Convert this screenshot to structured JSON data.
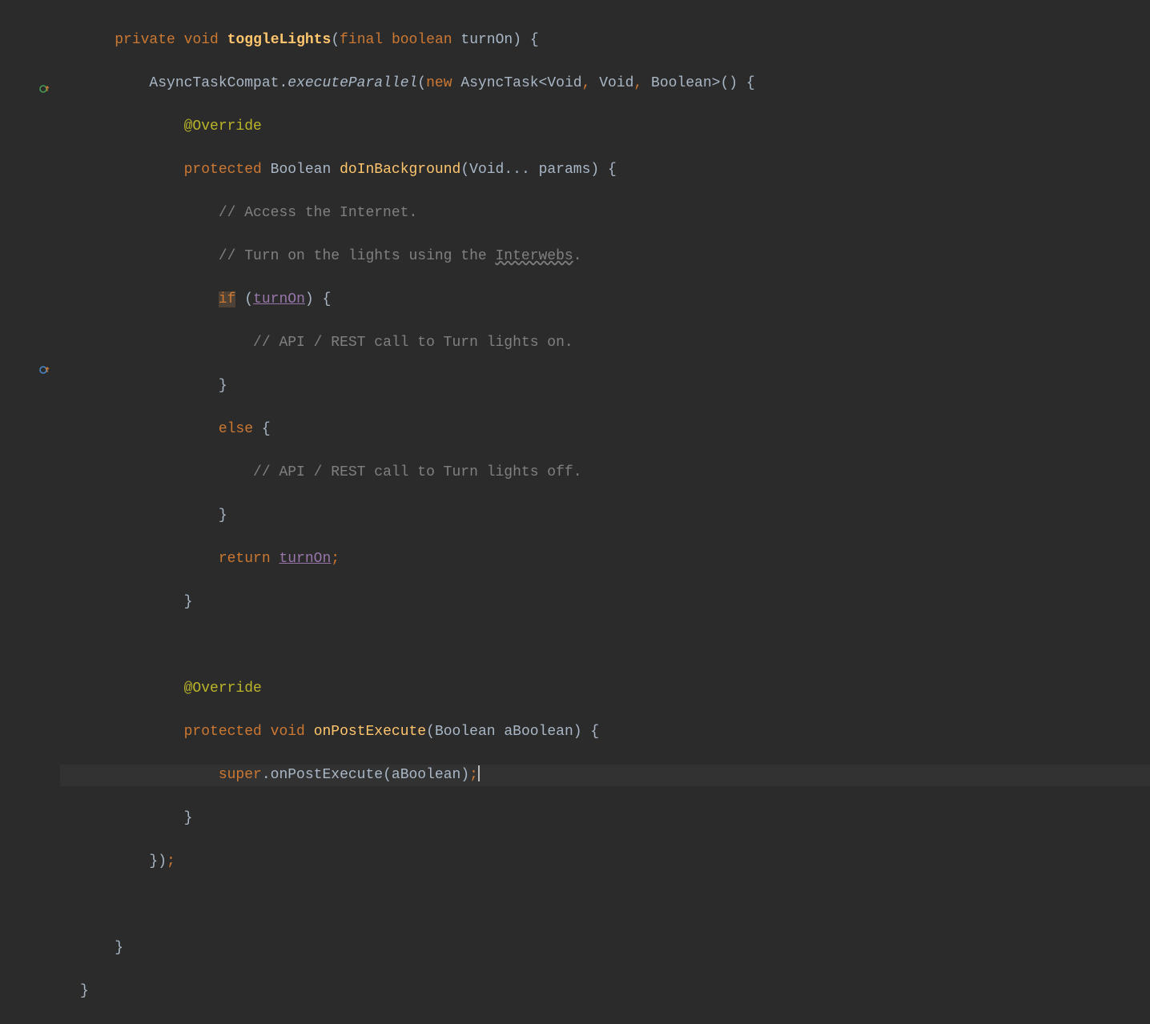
{
  "tokens": {
    "private": "private",
    "void": "void",
    "toggleLights": "toggleLights",
    "final": "final",
    "boolean": "boolean",
    "turnOn": "turnOn",
    "AsyncTaskCompat": "AsyncTaskCompat",
    "executeParallel": "executeParallel",
    "new": "new",
    "AsyncTask": "AsyncTask",
    "Void": "Void",
    "Boolean": "Boolean",
    "Override": "@Override",
    "protected": "protected",
    "doInBackground": "doInBackground",
    "params": "params",
    "comment_access": "// Access the Internet.",
    "comment_turnon_prefix": "// Turn on the lights using the ",
    "comment_interwebs": "Interwebs",
    "if": "if",
    "comment_api_on": "// API / REST call to Turn lights on.",
    "else": "else",
    "comment_api_off": "// API / REST call to Turn lights off.",
    "return": "return",
    "onPostExecute": "onPostExecute",
    "aBoolean": "aBoolean",
    "super": "super",
    "dot": ".",
    "comma": ",",
    "semi": ";",
    "lparen": "(",
    "rparen": ")",
    "lbrace": "{",
    "rbrace": "}",
    "lt": "<",
    "gt": ">",
    "ellipsis": "..."
  },
  "gutter": {
    "override_green": "override-marker-green",
    "override_blue": "override-marker-blue"
  }
}
